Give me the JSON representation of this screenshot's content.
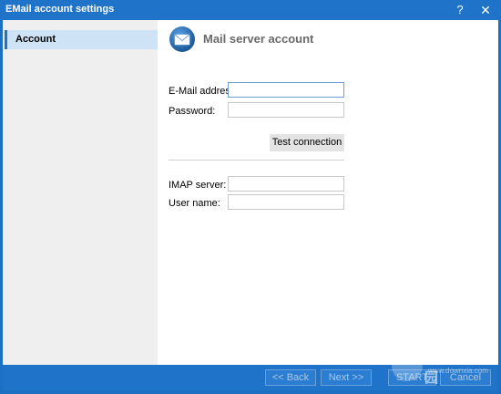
{
  "window": {
    "title": "EMail account settings",
    "help_glyph": "?",
    "close_glyph": "✕"
  },
  "sidebar": {
    "items": [
      {
        "label": "Account",
        "selected": true
      }
    ]
  },
  "main": {
    "title": "Mail server account",
    "icon": "mail-envelope-icon",
    "fields": {
      "email": {
        "label": "E-Mail address:",
        "value": "",
        "focused": true
      },
      "password": {
        "label": "Password:",
        "value": ""
      },
      "imap": {
        "label": "IMAP server:",
        "value": ""
      },
      "username": {
        "label": "User name:",
        "value": ""
      }
    },
    "test_button": "Test connection"
  },
  "footer": {
    "back_label": "<< Back",
    "next_label": "Next >>",
    "start_label": "START",
    "cancel_label": "Cancel"
  },
  "watermark": {
    "text": "当下软件园",
    "url": "www.downxia.com"
  },
  "colors": {
    "accent": "#1f73c8",
    "sidebar_bg": "#efefef",
    "selected_bg": "#cfe3f6",
    "title_gray": "#6a6a6a"
  }
}
